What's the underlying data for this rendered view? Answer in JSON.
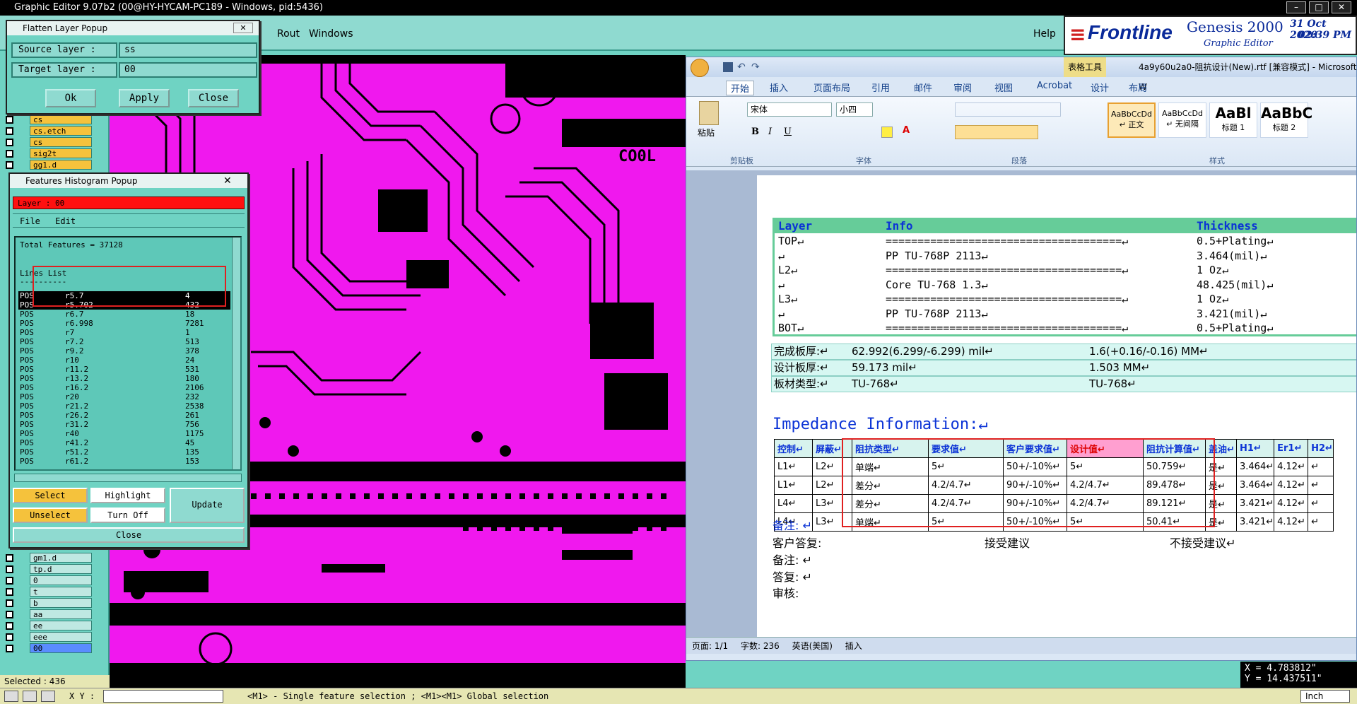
{
  "genesis": {
    "title": "Graphic Editor 9.07b2 (00@HY-HYCAM-PC189 - Windows, pid:5436)",
    "menus": [
      "Rout",
      "Windows"
    ],
    "help": "Help",
    "brand": {
      "company": "Frontline",
      "product": "Genesis 2000",
      "subtitle": "Graphic Editor",
      "date": "31 Oct 2020",
      "time": "02:39 PM"
    },
    "coords": {
      "x": "X = 4.783812\"",
      "y": "Y = 14.437511\""
    },
    "selected": "Selected : 436",
    "status_hint": "<M1> - Single feature selection ; <M1><M1> Global selection",
    "xy_label": "X Y :",
    "units": "Inch",
    "canvas_labels": [
      "CO0L"
    ],
    "colors": {
      "canvas": "#f018ee",
      "panel": "#6fd3c3"
    }
  },
  "layers": {
    "items": [
      "cs",
      "cs.etch",
      "cs",
      "sig2t",
      "gg1.d",
      "gm1.d",
      "tp.d",
      "0",
      "t",
      "b",
      "aa",
      "ee",
      "eee",
      "00"
    ]
  },
  "flatten": {
    "title": "Flatten Layer Popup",
    "source_label": "Source layer :",
    "source_value": "ss",
    "target_label": "Target layer :",
    "target_value": "00",
    "ok": "Ok",
    "apply": "Apply",
    "close": "Close"
  },
  "histogram": {
    "title": "Features Histogram Popup",
    "layer": "Layer : 00",
    "menu_file": "File",
    "menu_edit": "Edit",
    "total": "Total Features = 37128",
    "section": "Lines List",
    "divider": "----------",
    "rows": [
      {
        "pol": "POS",
        "sym": "r5.7",
        "count": "4"
      },
      {
        "pol": "POS",
        "sym": "r5.702",
        "count": "432"
      },
      {
        "pol": "POS",
        "sym": "r6.7",
        "count": "18"
      },
      {
        "pol": "POS",
        "sym": "r6.998",
        "count": "7281"
      },
      {
        "pol": "POS",
        "sym": "r7",
        "count": "1"
      },
      {
        "pol": "POS",
        "sym": "r7.2",
        "count": "513"
      },
      {
        "pol": "POS",
        "sym": "r9.2",
        "count": "378"
      },
      {
        "pol": "POS",
        "sym": "r10",
        "count": "24"
      },
      {
        "pol": "POS",
        "sym": "r11.2",
        "count": "531"
      },
      {
        "pol": "POS",
        "sym": "r13.2",
        "count": "180"
      },
      {
        "pol": "POS",
        "sym": "r16.2",
        "count": "2106"
      },
      {
        "pol": "POS",
        "sym": "r20",
        "count": "232"
      },
      {
        "pol": "POS",
        "sym": "r21.2",
        "count": "2538"
      },
      {
        "pol": "POS",
        "sym": "r26.2",
        "count": "261"
      },
      {
        "pol": "POS",
        "sym": "r31.2",
        "count": "756"
      },
      {
        "pol": "POS",
        "sym": "r40",
        "count": "1175"
      },
      {
        "pol": "POS",
        "sym": "r41.2",
        "count": "45"
      },
      {
        "pol": "POS",
        "sym": "r51.2",
        "count": "135"
      },
      {
        "pol": "POS",
        "sym": "r61.2",
        "count": "153"
      }
    ],
    "buttons": {
      "select": "Select",
      "highlight": "Highlight",
      "update": "Update",
      "unselect": "Unselect",
      "turn_off": "Turn Off",
      "close": "Close"
    }
  },
  "word": {
    "title": "4a9y60u2a0-阻抗设计(New).rtf [兼容模式] - Microsoft W",
    "table_tools": "表格工具",
    "tabs": [
      "开始",
      "插入",
      "页面布局",
      "引用",
      "邮件",
      "审阅",
      "视图",
      "Acrobat",
      "设计",
      "布局"
    ],
    "font_name": "宋体",
    "font_size": "小四",
    "paste": "粘贴",
    "groups": [
      "剪贴板",
      "字体",
      "段落",
      "样式"
    ],
    "styles": [
      {
        "sample": "AaBbCcDd",
        "name": "↵ 正文"
      },
      {
        "sample": "AaBbCcDd",
        "name": "↵ 无间隔"
      },
      {
        "sample": "AaBl",
        "name": "标题 1"
      },
      {
        "sample": "AaBbC",
        "name": "标题 2"
      }
    ],
    "status": {
      "page": "页面: 1/1",
      "words": "字数: 236",
      "lang": "英语(美国)",
      "mode": "插入"
    },
    "stackup": {
      "headers": [
        "Layer",
        "Info",
        "Thickness"
      ],
      "rows": [
        {
          "layer": "TOP↵",
          "info": "=====================================↵",
          "thick": "0.5+Plating↵"
        },
        {
          "layer": "↵",
          "info": "PP     TU-768P    2113↵",
          "thick": "3.464(mil)↵"
        },
        {
          "layer": "L2↵",
          "info": "=====================================↵",
          "thick": "1 Oz↵"
        },
        {
          "layer": "↵",
          "info": "Core     TU-768    1.3↵",
          "thick": "48.425(mil)↵"
        },
        {
          "layer": "L3↵",
          "info": "=====================================↵",
          "thick": "1 Oz↵"
        },
        {
          "layer": "↵",
          "info": "PP     TU-768P    2113↵",
          "thick": "3.421(mil)↵"
        },
        {
          "layer": "BOT↵",
          "info": "=====================================↵",
          "thick": "0.5+Plating↵"
        }
      ]
    },
    "board": [
      {
        "label": "完成板厚:↵",
        "v1": "62.992(6.299/-6.299) mil↵",
        "v2": "1.6(+0.16/-0.16) MM↵"
      },
      {
        "label": "设计板厚:↵",
        "v1": "59.173 mil↵",
        "v2": "1.503 MM↵"
      },
      {
        "label": "板材类型:↵",
        "v1": "TU-768↵",
        "v2": "TU-768↵"
      }
    ],
    "impedance_title": "Impedance Information:↵",
    "imp_headers": [
      "控制↵",
      "屏蔽↵",
      "阻抗类型↵",
      "要求值↵",
      "客户要求值↵",
      "设计值↵",
      "阻抗计算值↵",
      "盖油↵",
      "H1↵",
      "Er1↵",
      "H2↵"
    ],
    "imp_rows": [
      [
        "L1↵",
        "L2↵",
        "单端↵",
        "5↵",
        "50+/-10%↵",
        "5↵",
        "50.759↵",
        "是↵",
        "3.464↵",
        "4.12↵",
        "↵"
      ],
      [
        "L1↵",
        "L2↵",
        "差分↵",
        "4.2/4.7↵",
        "90+/-10%↵",
        "4.2/4.7↵",
        "89.478↵",
        "是↵",
        "3.464↵",
        "4.12↵",
        "↵"
      ],
      [
        "L4↵",
        "L3↵",
        "差分↵",
        "4.2/4.7↵",
        "90+/-10%↵",
        "4.2/4.7↵",
        "89.121↵",
        "是↵",
        "3.421↵",
        "4.12↵",
        "↵"
      ],
      [
        "L4↵",
        "L3↵",
        "单端↵",
        "5↵",
        "50+/-10%↵",
        "5↵",
        "50.41↵",
        "是↵",
        "3.421↵",
        "4.12↵",
        "↵"
      ]
    ],
    "notes": {
      "remark": "备注: ↵",
      "reply": "客户答复:",
      "accept": "接受建议",
      "reject": "不接受建议↵",
      "remark2": "备注: ↵",
      "answer": "答复: ↵",
      "review": "审核:"
    }
  }
}
